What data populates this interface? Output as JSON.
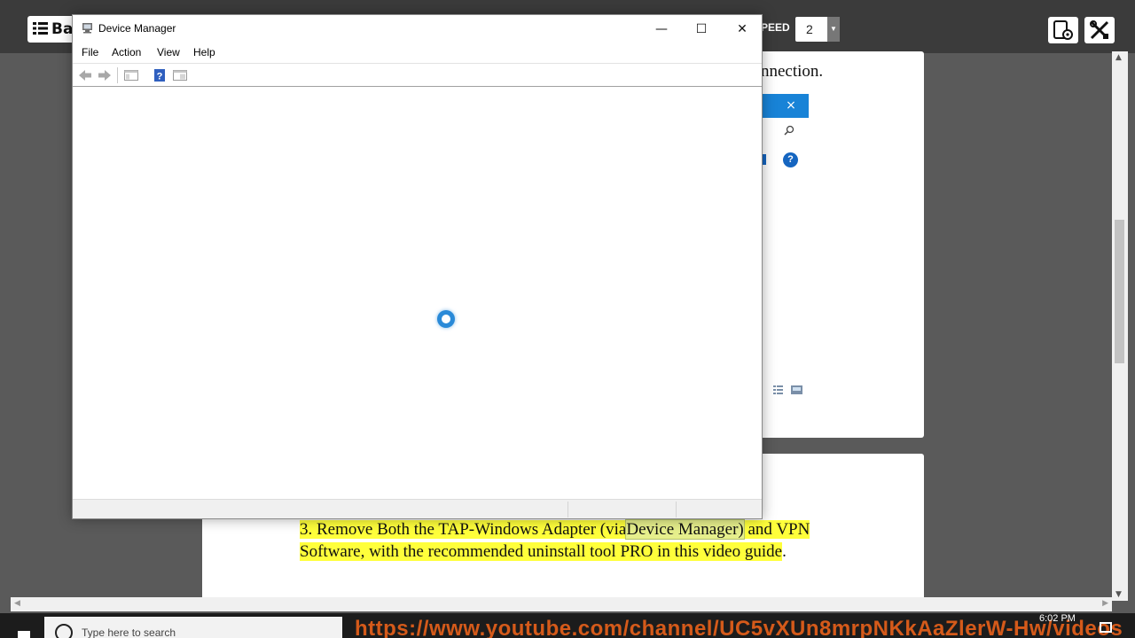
{
  "reader": {
    "back_label": "Ba",
    "speed_label": "PEED",
    "speed_value": "2",
    "paragraph": {
      "part1": "3. Remove Both the TAP-Windows Adapter (via",
      "link": "Device Manager)",
      "part2": "and VPN Software, with the recommended uninstall tool PRO in this video guide",
      "end": "."
    },
    "connection_fragment": "nnection.",
    "close_glyph": "×",
    "help_glyph": "?"
  },
  "device_manager": {
    "title": "Device Manager",
    "menu": [
      "File",
      "Action",
      "View",
      "Help"
    ],
    "icons": {
      "back": "back-arrow-icon",
      "forward": "forward-arrow-icon",
      "show_hide": "show-hide-console-tree-icon",
      "help": "help-icon",
      "properties": "properties-icon"
    },
    "window_controls": {
      "minimize": "—",
      "maximize": "☐",
      "close": "✕"
    }
  },
  "taskbar": {
    "search_placeholder": "Type here to search",
    "watermark_url": "https://www.youtube.com/channel/UC5vXUn8mrpNKkAaZlerW-Hw/videos",
    "time": "6:02 PM"
  },
  "colors": {
    "reader_bg": "#5a5a5a",
    "topbar": "#3b3b3b",
    "highlight": "#ffff3b",
    "accent_blue": "#1883d7",
    "watermark": "#e5601a"
  }
}
